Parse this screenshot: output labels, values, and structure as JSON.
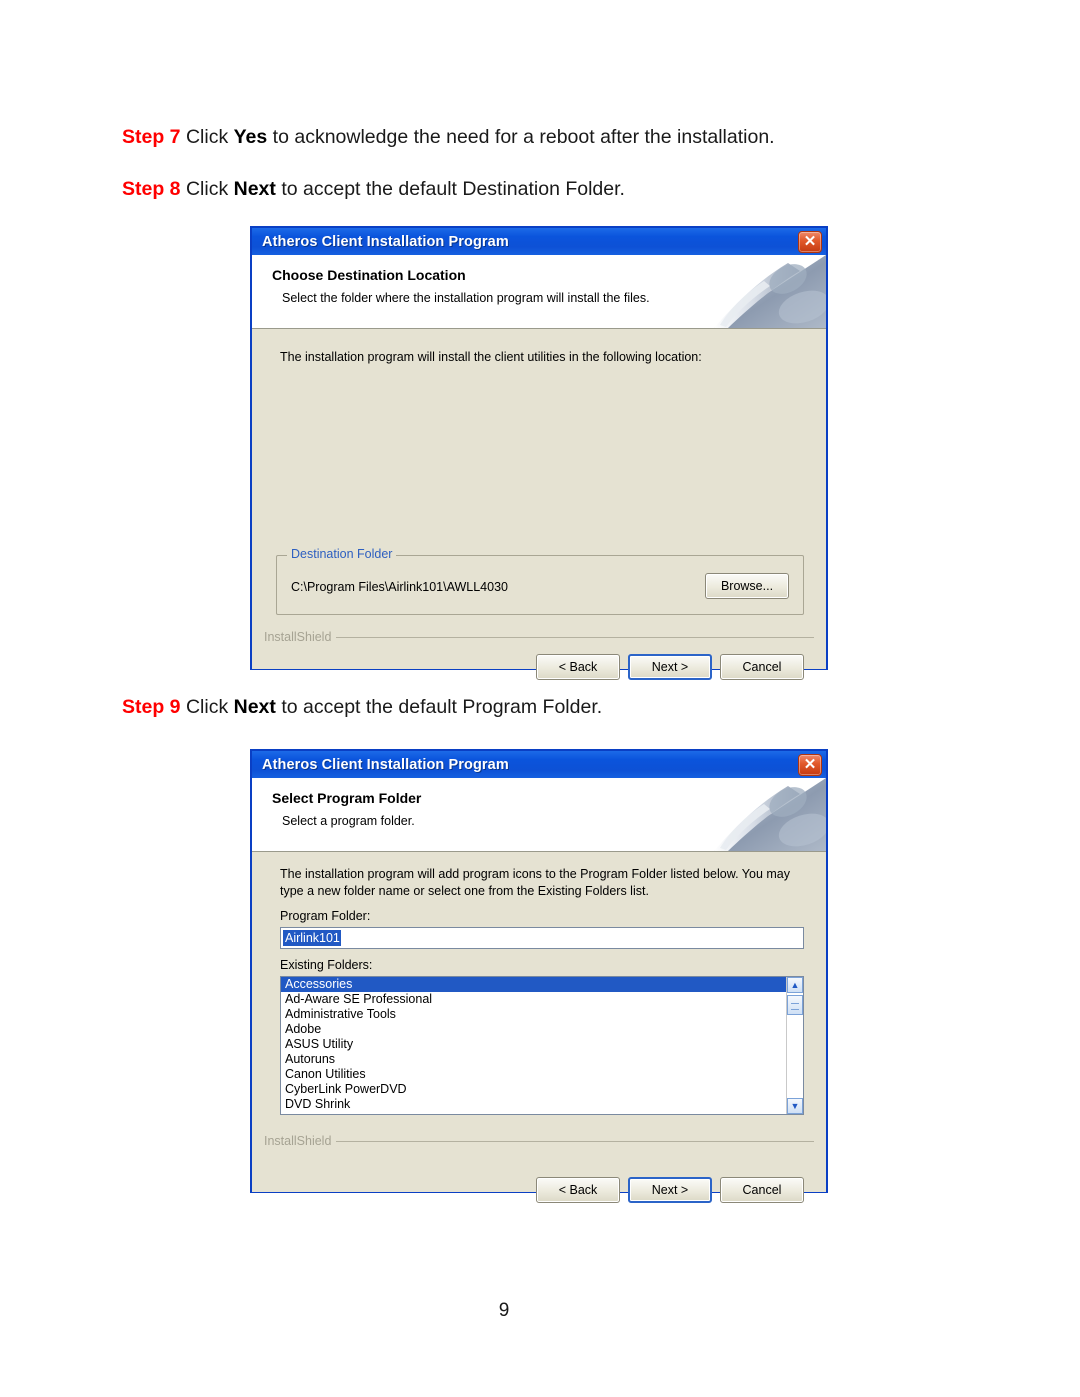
{
  "document": {
    "page_number": "9",
    "steps": [
      {
        "id": "step7",
        "label": "Step 7",
        "text_before": " Click ",
        "emphasis": "Yes",
        "text_after": " to acknowledge the need for a reboot after the installation."
      },
      {
        "id": "step8",
        "label": "Step 8",
        "text_before": " Click ",
        "emphasis": "Next",
        "text_after": " to accept the default Destination Folder."
      },
      {
        "id": "step9",
        "label": "Step 9",
        "text_before": " Click ",
        "emphasis": "Next",
        "text_after": " to accept the default Program Folder."
      }
    ]
  },
  "colors": {
    "step_label": "#ff0000",
    "titlebar_blue": "#0d51d6",
    "dialog_body": "#e5e2d2",
    "selection_blue": "#2159c4",
    "groupbox_legend": "#2d5fc0",
    "close_button_red": "#c43a12"
  },
  "dialog1": {
    "title": "Atheros Client Installation Program",
    "close_label": "✕",
    "header_title": "Choose Destination Location",
    "header_subtitle": "Select the folder where the installation program will install the files.",
    "body_text": "The installation program will install the client utilities in the following location:",
    "groupbox_legend": "Destination Folder",
    "destination_path": "C:\\Program Files\\Airlink101\\AWLL4030",
    "browse_label": "Browse...",
    "installshield_label": "InstallShield",
    "buttons": {
      "back": "< Back",
      "next": "Next >",
      "cancel": "Cancel"
    }
  },
  "dialog2": {
    "title": "Atheros Client Installation Program",
    "close_label": "✕",
    "header_title": "Select Program Folder",
    "header_subtitle": "Select a program folder.",
    "body_text_line1": "The installation program will add program icons to the Program Folder listed below. You may",
    "body_text_line2": "type a new folder name or select one from the Existing Folders list.",
    "program_folder_label": "Program Folder:",
    "program_folder_value": "Airlink101",
    "existing_folders_label": "Existing Folders:",
    "existing_folders": [
      "Accessories",
      "Ad-Aware SE Professional",
      "Administrative Tools",
      "Adobe",
      "ASUS Utility",
      "Autoruns",
      "Canon Utilities",
      "CyberLink PowerDVD",
      "DVD Shrink"
    ],
    "selected_folder_index": 0,
    "scrollbar": {
      "up_arrow": "▲",
      "down_arrow": "▼"
    },
    "installshield_label": "InstallShield",
    "buttons": {
      "back": "< Back",
      "next": "Next >",
      "cancel": "Cancel"
    }
  }
}
